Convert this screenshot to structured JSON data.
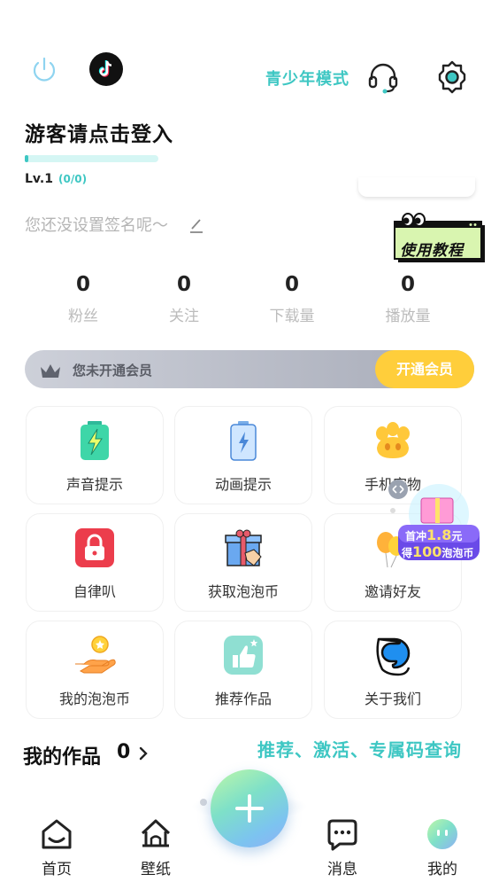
{
  "header": {
    "youth_mode": "青少年模式",
    "login_title": "游客请点击登入",
    "level": "Lv.1",
    "level_progress": "(0/0)",
    "level_fill": 0.0,
    "signature": "您还没设置签名呢～",
    "tutorial_badge": "使用教程"
  },
  "stats": [
    {
      "value": "0",
      "label": "粉丝"
    },
    {
      "value": "0",
      "label": "关注"
    },
    {
      "value": "0",
      "label": "下载量"
    },
    {
      "value": "0",
      "label": "播放量"
    }
  ],
  "vip": {
    "status": "您未开通会员",
    "button": "开通会员"
  },
  "features": [
    {
      "label": "声音提示",
      "icon": "battery-green-icon"
    },
    {
      "label": "动画提示",
      "icon": "battery-blue-icon"
    },
    {
      "label": "手机宠物",
      "icon": "paw-icon"
    },
    {
      "label": "自律叭",
      "icon": "lock-icon"
    },
    {
      "label": "获取泡泡币",
      "icon": "gift-box-icon"
    },
    {
      "label": "邀请好友",
      "icon": "balloon-icon"
    },
    {
      "label": "我的泡泡币",
      "icon": "coin-hand-icon"
    },
    {
      "label": "推荐作品",
      "icon": "thumbs-up-icon"
    },
    {
      "label": "关于我们",
      "icon": "app-logo-icon"
    }
  ],
  "promo": {
    "line1_prefix": "首冲",
    "line1_amount": "1.8",
    "line1_suffix": "元",
    "line2_prefix": "得",
    "line2_amount": "100",
    "line2_suffix": "泡泡币"
  },
  "works": {
    "title": "我的作品",
    "count": "0",
    "query_link": "推荐、激活、专属码查询"
  },
  "nav": [
    {
      "label": "首页",
      "icon": "home-icon"
    },
    {
      "label": "壁纸",
      "icon": "wallpaper-house-icon"
    },
    {
      "label": "消息",
      "icon": "message-icon"
    },
    {
      "label": "我的",
      "icon": "profile-avatar-icon"
    }
  ],
  "colors": {
    "accent": "#3ec7c3",
    "vip_button": "#ffce3b"
  }
}
